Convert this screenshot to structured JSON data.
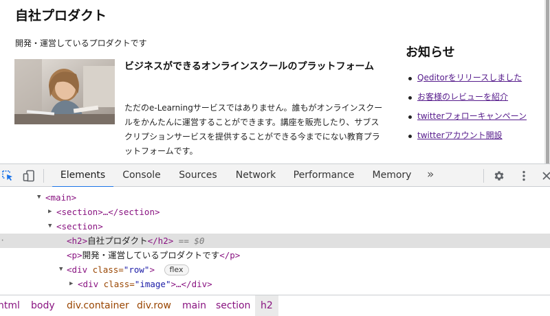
{
  "page": {
    "title": "自社プロダクト",
    "subtitle": "開発・運営しているプロダクトです",
    "article": {
      "title": "ビジネスができるオンラインスクールのプラットフォーム",
      "body": "ただのe-Learningサービスではありません。誰もがオンラインスクールをかんたんに運営することができます。講座を販売したり、サブスクリプションサービスを提供することができる今までにない教育プラットフォームです。"
    },
    "news": {
      "title": "お知らせ",
      "items": [
        "Qeditorをリリースしました",
        "お客様のレビューを紹介",
        "twitterフォローキャンペーン",
        "twitterアカウント開設"
      ]
    }
  },
  "devtools": {
    "tabs": [
      "Elements",
      "Console",
      "Sources",
      "Network",
      "Performance",
      "Memory"
    ],
    "active_tab": "Elements",
    "more_tabs": "»",
    "accent_color": "#1a73e8",
    "icons": [
      "inspect-element-icon",
      "device-toggle-icon",
      "settings-gear-icon",
      "kebab-menu-icon",
      "close-icon"
    ],
    "dom": {
      "main_open": "<main>",
      "section1": "<section>…</section>",
      "section2_open": "<section>",
      "h2_open": "<h2>",
      "h2_text": "自社プロダクト",
      "h2_close": "</h2>",
      "h2_marker": "== $0",
      "p_open": "<p>",
      "p_text": "開発・運営しているプロダクトです",
      "p_close": "</p>",
      "div_row_tag": "<div",
      "div_row_attr": "class=",
      "div_row_val": "\"row\"",
      "div_row_end": ">",
      "flex_badge": "flex",
      "div_image_tag": "<div",
      "div_image_attr": "class=",
      "div_image_val": "\"image\"",
      "div_image_end": ">…</div>"
    },
    "breadcrumbs": [
      "html",
      "body",
      "div.container",
      "div.row",
      "main",
      "section",
      "h2"
    ]
  }
}
